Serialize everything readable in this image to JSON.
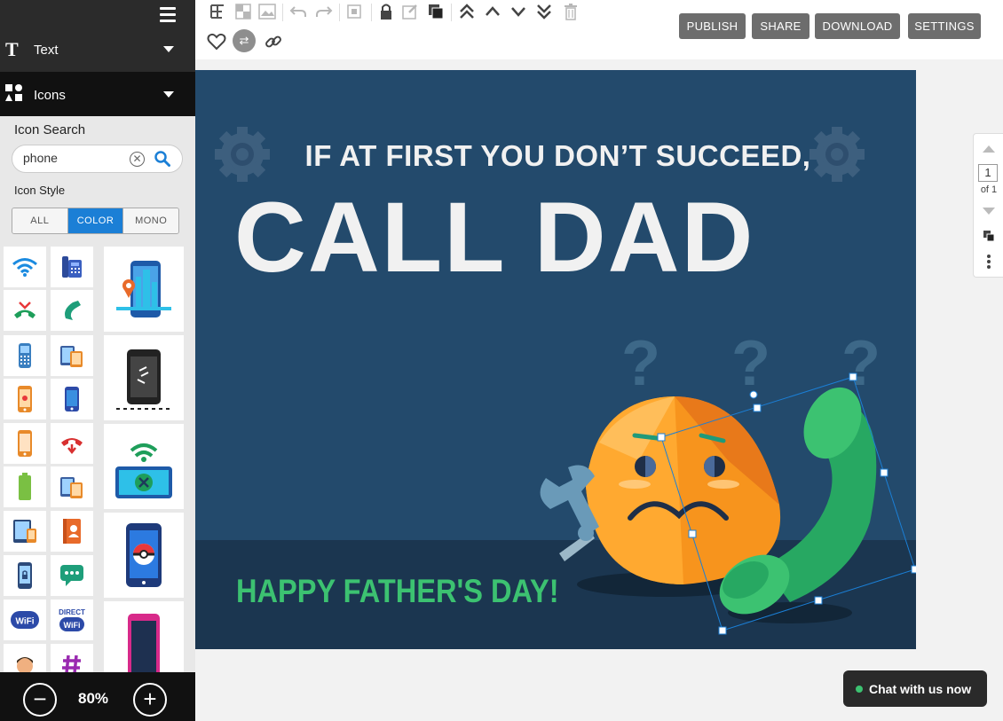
{
  "sidebar": {
    "sections": [
      {
        "label": "Text",
        "icon": "text-T-icon"
      },
      {
        "label": "Icons",
        "icon": "shapes-icon"
      }
    ],
    "icon_search_label": "Icon Search",
    "search_value": "phone",
    "icon_style_label": "Icon Style",
    "style_options": [
      "ALL",
      "COLOR",
      "MONO"
    ],
    "style_selected": "COLOR",
    "zoom": "80%",
    "icon_results": [
      "wifi-icon",
      "desk-phone-icon",
      "city-phone-map-icon",
      "missed-call-icon",
      "handset-icon",
      "mobile-keypad-icon",
      "devices-icon",
      "phone-signal-icon",
      "smartphone-camera-icon",
      "smartphone-blue-icon",
      "smartphone-orange-icon",
      "hang-up-icon",
      "wifi-mobile-icon",
      "battery-phone-icon",
      "devices-orange-icon",
      "tablet-phone-icon",
      "contact-book-icon",
      "pokeball-phone-icon",
      "locked-phone-icon",
      "chat-bubble-icon",
      "wifi-badge-icon",
      "wifi-direct-icon",
      "pink-phone-icon",
      "person-avatar-icon",
      "hashtag-icon"
    ],
    "wifi_badge_text": "WiFi",
    "wifi_direct_text": "DIRECT"
  },
  "toolbar": {
    "buttons": [
      "PUBLISH",
      "SHARE",
      "DOWNLOAD",
      "SETTINGS"
    ],
    "icons": [
      "paragraph-icon",
      "checker-icon",
      "image-icon",
      "undo-icon",
      "redo-icon",
      "crop-icon",
      "lock-icon",
      "edit-icon",
      "duplicate-icon",
      "bring-to-front-icon",
      "bring-forward-icon",
      "send-backward-icon",
      "send-to-back-icon",
      "trash-icon",
      "heart-icon",
      "swap-icon",
      "link-icon"
    ]
  },
  "canvas": {
    "headline1": "IF AT FIRST YOU DON’T SUCCEED,",
    "headline2": "CALL DAD",
    "footer": "HAPPY FATHER'S DAY!",
    "question_marks": "? ? ?",
    "background_color": "#234a6c",
    "accent_green": "#3cc271"
  },
  "page_panel": {
    "current": "1",
    "of_label": "of 1"
  },
  "chat": {
    "label": "Chat with us now"
  }
}
